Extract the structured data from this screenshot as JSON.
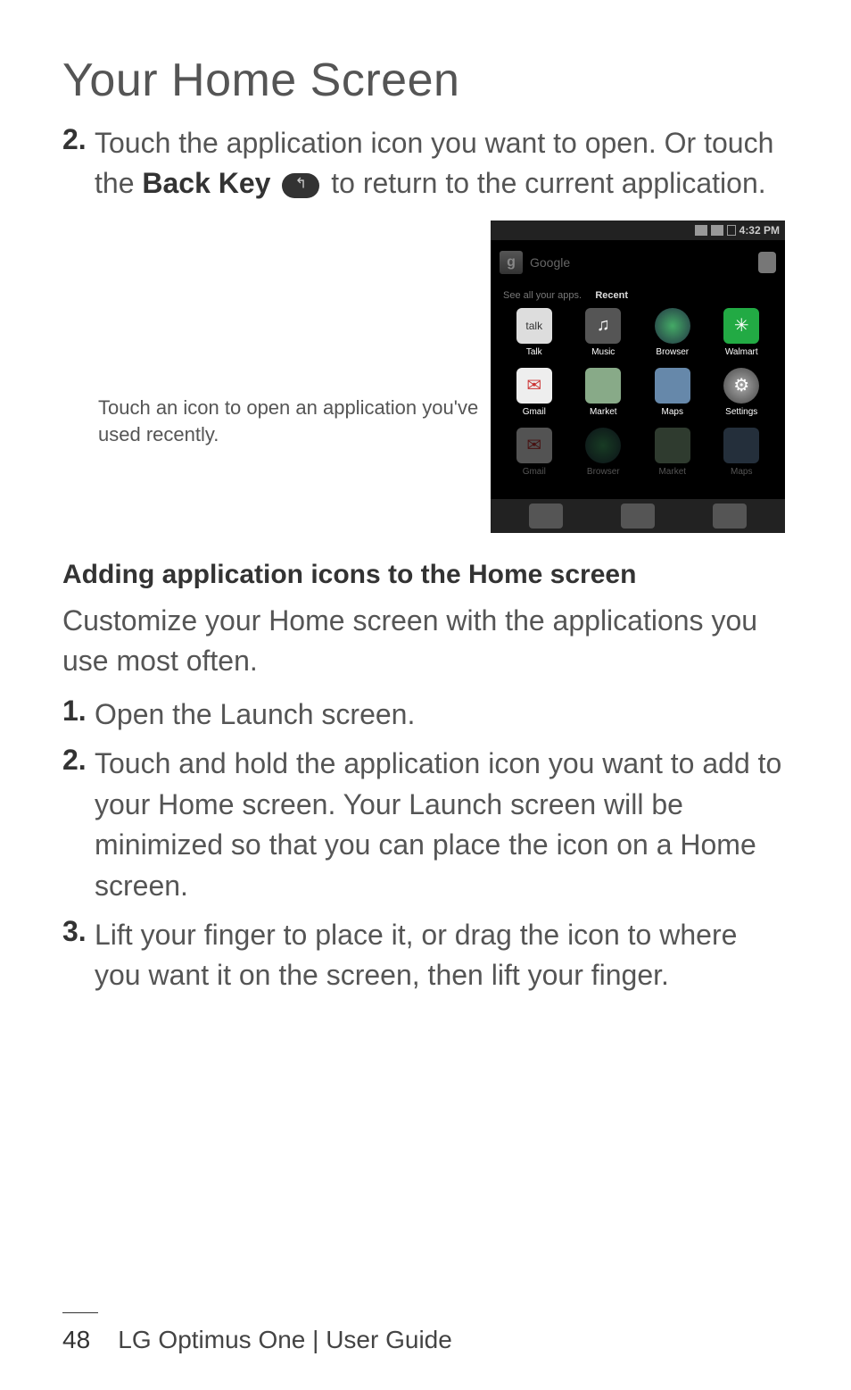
{
  "title": "Your Home Screen",
  "step_top": {
    "num": "2.",
    "text_before": "Touch the application icon you want to open. Or touch the ",
    "bold": "Back Key",
    "text_after": "  to return to the current application."
  },
  "callout": "Touch an icon to open an application you've used recently.",
  "screenshot": {
    "time": "4:32 PM",
    "search_placeholder": "Google",
    "see_all": "See all your apps.",
    "recent": "Recent",
    "apps_row1": [
      {
        "label": "Talk",
        "glyph": "talk",
        "cls": "ic-talk"
      },
      {
        "label": "Music",
        "glyph": "♫",
        "cls": "ic-music"
      },
      {
        "label": "Browser",
        "glyph": "",
        "cls": "ic-browser"
      },
      {
        "label": "Walmart",
        "glyph": "✳",
        "cls": "ic-walmart"
      }
    ],
    "apps_row2": [
      {
        "label": "Gmail",
        "glyph": "✉",
        "cls": "ic-gmail"
      },
      {
        "label": "Market",
        "glyph": "",
        "cls": "ic-market"
      },
      {
        "label": "Maps",
        "glyph": "",
        "cls": "ic-maps"
      },
      {
        "label": "Settings",
        "glyph": "⚙",
        "cls": "ic-settings"
      }
    ],
    "apps_dim": [
      {
        "label": "Gmail",
        "glyph": "✉",
        "cls": "ic-gmail"
      },
      {
        "label": "Browser",
        "glyph": "",
        "cls": "ic-browser"
      },
      {
        "label": "Market",
        "glyph": "",
        "cls": "ic-market"
      },
      {
        "label": "Maps",
        "glyph": "",
        "cls": "ic-maps"
      }
    ]
  },
  "section_heading": "Adding application icons to the Home screen",
  "intro": "Customize your Home screen with the applications you use most often.",
  "steps": [
    {
      "num": "1.",
      "text": "Open the Launch screen."
    },
    {
      "num": "2.",
      "text": "Touch and hold the application icon you want to add to your Home screen. Your Launch screen will be minimized so that you can place the icon on a Home screen."
    },
    {
      "num": "3.",
      "text": "Lift your finger to place it, or drag the icon to where you want it on the screen, then lift your finger."
    }
  ],
  "footer": {
    "page": "48",
    "text": "LG Optimus One  |  User Guide"
  }
}
